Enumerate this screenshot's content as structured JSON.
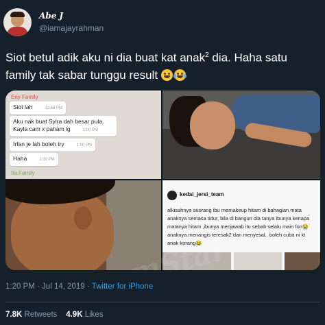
{
  "user": {
    "display_name": "Abe J",
    "handle": "@iamajayrahman"
  },
  "tweet": {
    "line1": "Siot betul adik aku ni dia buat kat anak",
    "sup": "2",
    "line1_end": " dia. Haha satu",
    "line2": "family tak sabar tunggu result"
  },
  "chat": {
    "group_top": "Eny Family",
    "group_bottom": "Ita Family",
    "messages": [
      {
        "text": "Siot lah",
        "time": "12:59 PM"
      },
      {
        "text": "Aku nak buat Syira dah besar pula. Kayla cam x paham lg",
        "time": "1:00 PM"
      },
      {
        "text": "Irfan je lah boleh try",
        "time": "1:00 PM"
      },
      {
        "text": "Haha",
        "time": "1:00 PM"
      }
    ]
  },
  "instagram": {
    "username": "kedai_jersi_team",
    "caption": "alkisahnya seorang ibu memakeup hitam di bahagian mata anaknya semasa tidur, bila di bangun dia tanya ibunya kenapa matanya hitam ,ibunya menjawab itu sebab selalu main fon😭anaknya menangis teresak2 dan menyesal.. boleh cuba ni kt anak korang😂"
  },
  "watermark": "mStar",
  "meta": {
    "time": "1:20 PM · Jul 14, 2019 · ",
    "source": "Twitter for iPhone"
  },
  "stats": {
    "retweets_count": "7.8K",
    "retweets_label": "Retweets",
    "likes_count": "4.9K",
    "likes_label": "Likes"
  },
  "icons": {
    "emoji_1": "grinning-face",
    "emoji_2": "face-with-tears-of-joy"
  }
}
